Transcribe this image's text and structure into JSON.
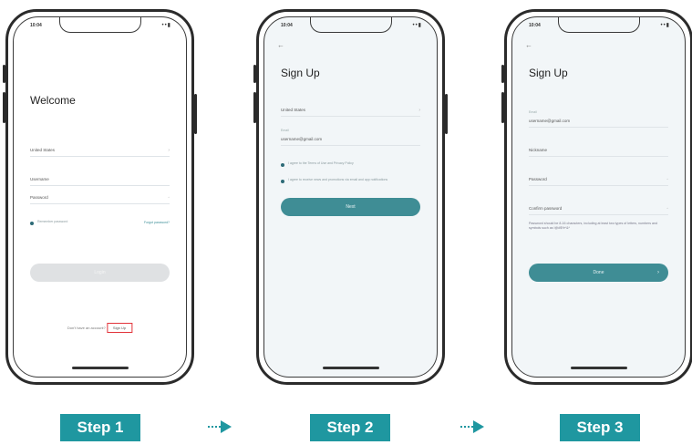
{
  "status_bar": {
    "time": "10:04",
    "icons": "••▮"
  },
  "phone1": {
    "title": "Welcome",
    "region_value": "United States",
    "username_label": "Username",
    "password_placeholder": "Password",
    "remember_text": "Remember password",
    "forgot_text": "Forgot password?",
    "login_label": "Login",
    "signup_prompt": "Don't have an account?",
    "signup_link": "Sign Up"
  },
  "phone2": {
    "back": "←",
    "title": "Sign Up",
    "region_value": "United States",
    "email_label": "Email",
    "email_value": "username@gmail.com",
    "agree1": "I agree to the Terms of Use and Privacy Policy",
    "agree2": "I agree to receive news and promotions via email and app notifications",
    "next_label": "Next"
  },
  "phone3": {
    "back": "←",
    "title": "Sign Up",
    "email_label": "Email",
    "email_value": "username@gmail.com",
    "nickname_placeholder": "Nickname",
    "password_placeholder": "Password",
    "confirm_placeholder": "Confirm password",
    "password_note": "Password should be 8-16 characters, including at least two types of letters, numbers and symbols such as !@#$%^&*",
    "done_label": "Done"
  },
  "steps": [
    "Step 1",
    "Step 2",
    "Step 3"
  ],
  "colors": {
    "accent": "#1f97a0",
    "button": "#3f8d95",
    "highlight": "#e2333a"
  }
}
